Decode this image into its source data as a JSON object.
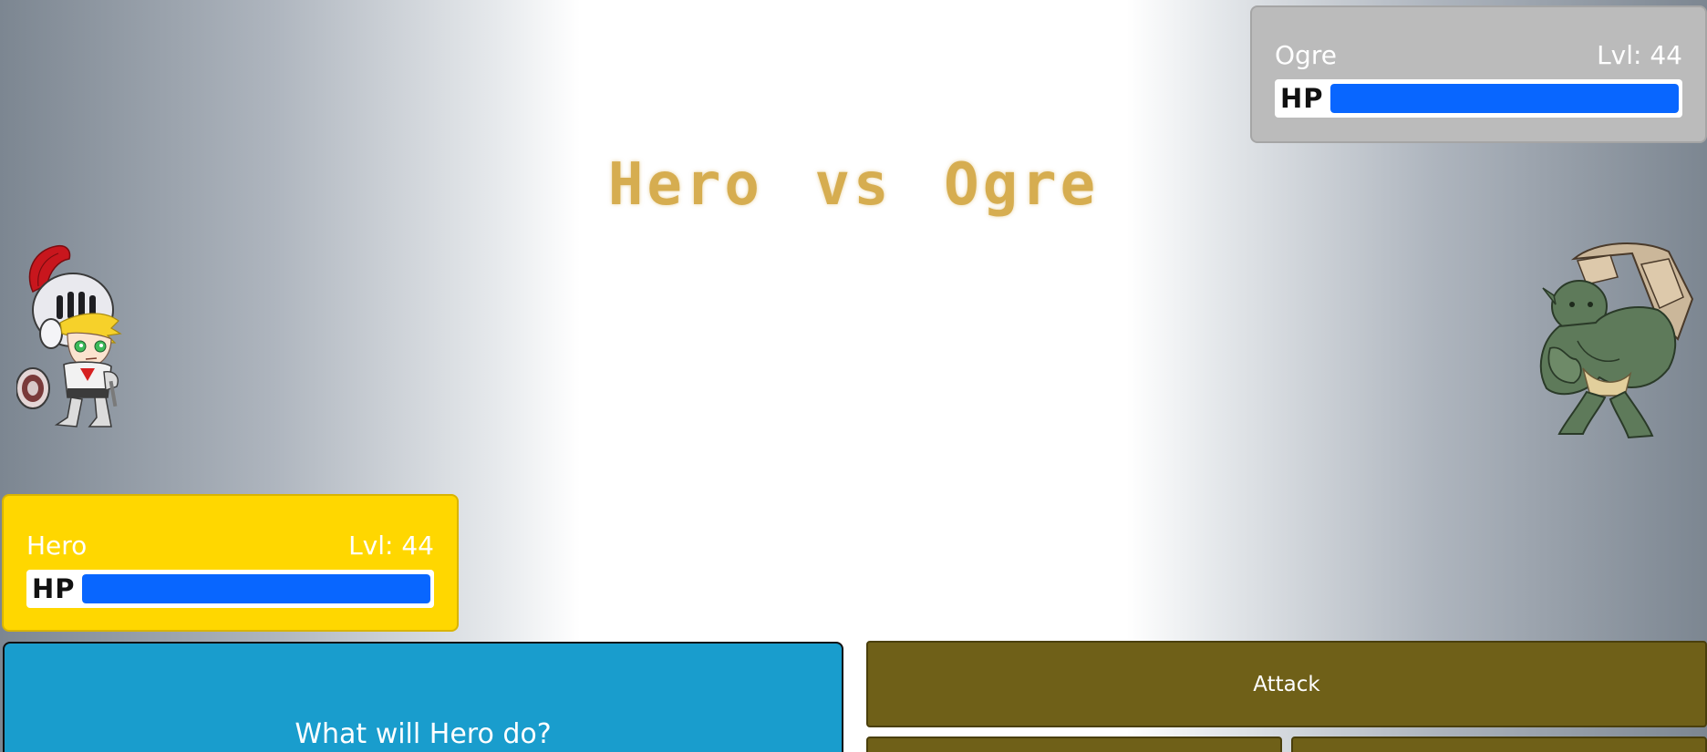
{
  "title": "Hero vs Ogre",
  "enemy": {
    "name": "Ogre",
    "level": "Lvl: 44",
    "hp_label": "HP",
    "hp_fraction": 1.0,
    "sprite": "ogre-sprite"
  },
  "player": {
    "name": "Hero",
    "level": "Lvl: 44",
    "hp_label": "HP",
    "hp_fraction": 1.0,
    "sprite": "knight-sprite"
  },
  "message": "What will Hero do?",
  "actions": {
    "attack_label": "Attack",
    "action2_label": "",
    "action3_label": ""
  },
  "colors": {
    "hp_bar": "#0866ff",
    "player_panel": "#ffd700",
    "enemy_panel": "#bbbbbb",
    "message_box": "#199dcd",
    "action_button": "#6f6018",
    "title": "#d6ad50"
  }
}
